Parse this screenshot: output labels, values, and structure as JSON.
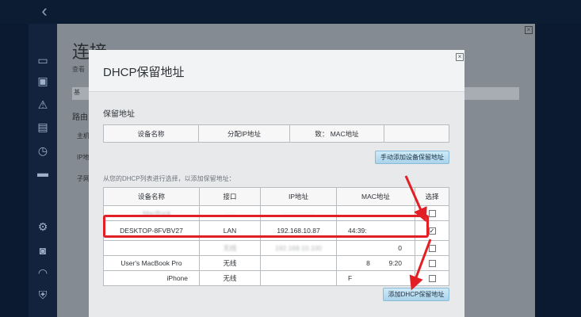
{
  "background": {
    "title": "连接",
    "subtitle": "查看",
    "tab": "基",
    "labels": [
      "路由",
      "主机",
      "IP地",
      "子网"
    ]
  },
  "modal": {
    "title": "DHCP保留地址",
    "section_title": "保留地址",
    "reserved_headers": [
      "设备名称",
      "分配IP地址",
      "致： MAC地址",
      ""
    ],
    "manual_add_button": "手动添加设备保留地址",
    "hint": "从您的DHCP列表进行选择，以添加保留地址：",
    "device_headers": [
      "设备名称",
      "接口",
      "IP地址",
      "MAC地址",
      "选择"
    ],
    "devices": [
      {
        "name": "·····MacBook",
        "iface": "·····",
        "ip": "···············",
        "mac": "",
        "checked": false,
        "partial": true
      },
      {
        "name": "DESKTOP-8FVBV27",
        "iface": "LAN",
        "ip": "192.168.10.87",
        "mac": "44:39:",
        "checked": true
      },
      {
        "name": "",
        "iface": "无线",
        "ip": "192.168.10.100",
        "mac": "0",
        "checked": false,
        "partial": true
      },
      {
        "name": "User's MacBook Pro",
        "iface": "无线",
        "ip": "",
        "mac": "8          9:20",
        "checked": false
      },
      {
        "name": "iPhone",
        "iface": "无线",
        "ip": "",
        "mac": "F",
        "checked": false
      }
    ],
    "add_reserved_button": "添加DHCP保留地址"
  },
  "icons": [
    "back-icon",
    "monitor-icon",
    "toolbox-icon",
    "warning-icon",
    "devices-icon",
    "clock-icon",
    "media-icon",
    "settings-icon",
    "security-icon",
    "wifi-icon",
    "shield-icon"
  ],
  "colors": {
    "highlight": "#e11f25",
    "button": "#a9d3ea"
  }
}
